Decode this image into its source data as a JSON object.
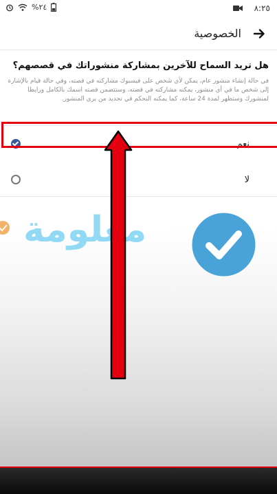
{
  "status_bar": {
    "time": "٨:٢٥",
    "battery": "%٢٤"
  },
  "header": {
    "title": "الخصوصية"
  },
  "content": {
    "question": "هل تريد السماح للآخرين بمشاركة منشوراتك في قصصهم؟",
    "description": "في حالة إنشاء منشور عام، يمكن لأي شخص على فيسبوك مشاركته في قصته، وفي حالة قيام بالإشارة إلى شخص ما في أي منشور، يمكنه مشاركته في قصته، وستتضمن قصته اسمك بالكامل ورابطا لمنشورك وستظهر لمدة 24 ساعة، كما يمكنه التحكم في تحديد من يرى المنشور.",
    "options": [
      {
        "label": "نعم",
        "selected": true
      },
      {
        "label": "لا",
        "selected": false
      }
    ]
  },
  "watermark": {
    "text": "معلومة"
  },
  "colors": {
    "highlight": "#e4000f",
    "radio_selected": "#3b5998",
    "watermark": "#7fd3f3"
  }
}
